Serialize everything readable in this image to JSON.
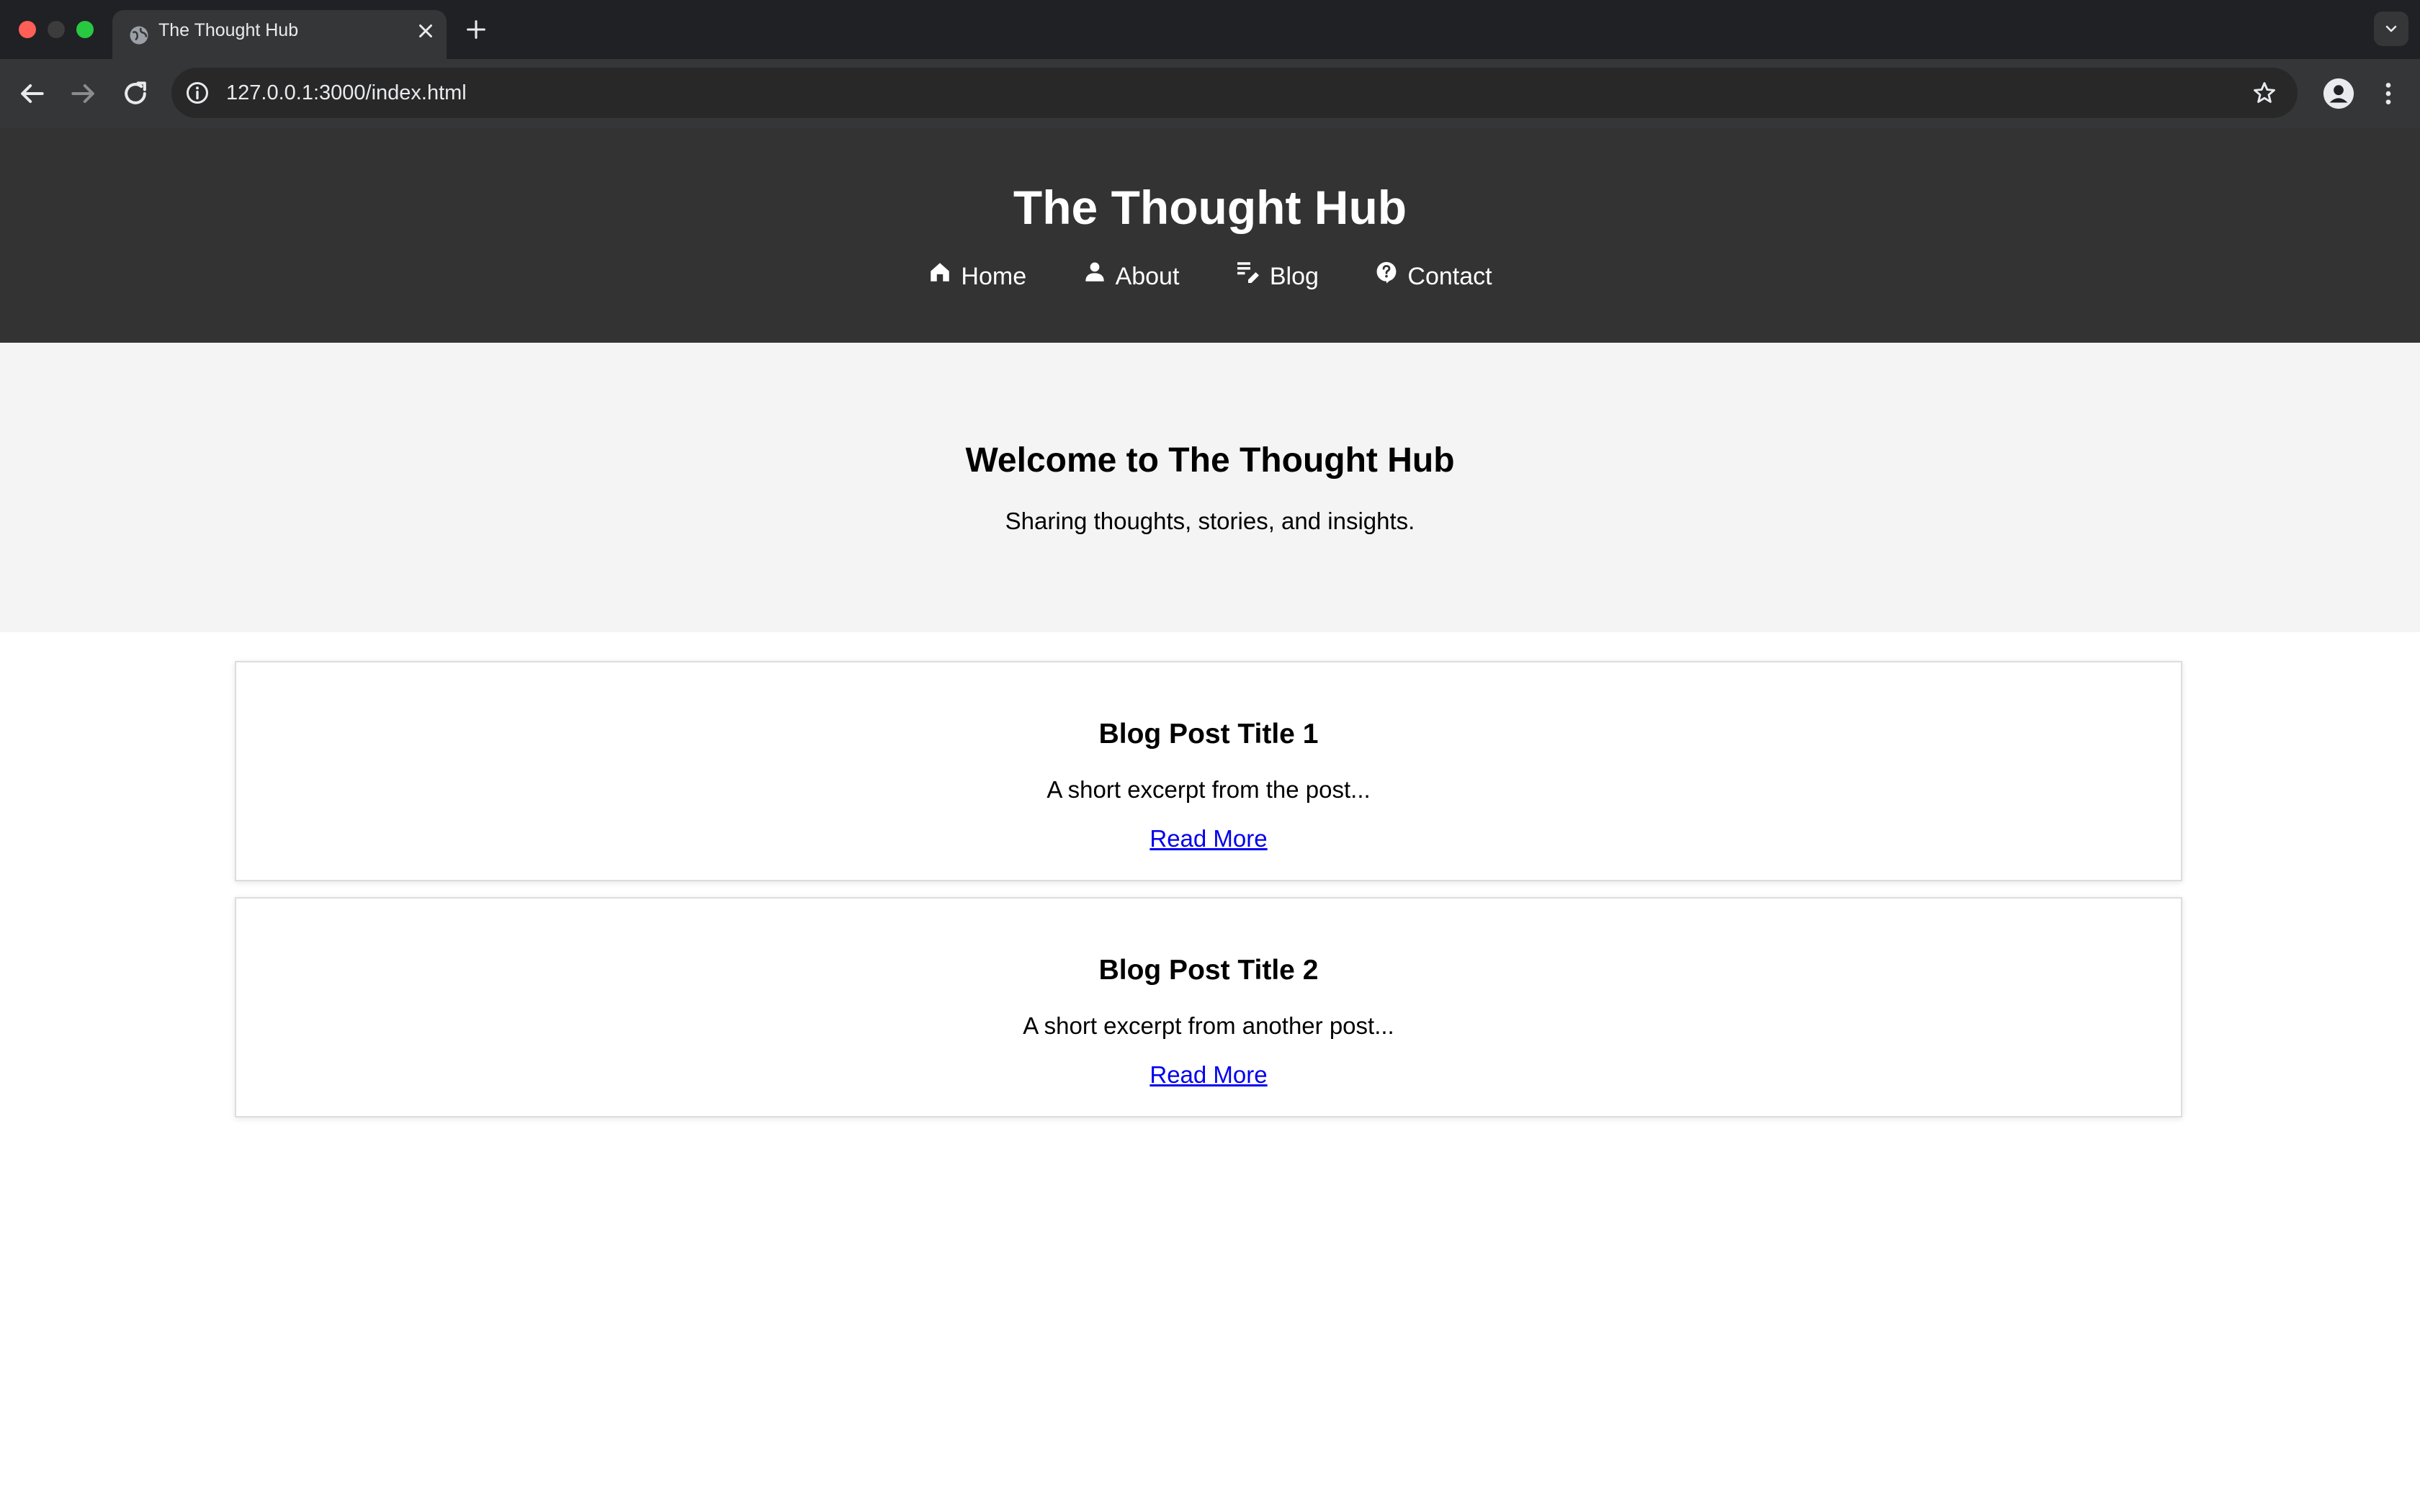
{
  "browser": {
    "tab": {
      "title": "The Thought Hub"
    },
    "address_bar": {
      "url": "127.0.0.1:3000/index.html"
    }
  },
  "header": {
    "title": "The Thought Hub",
    "nav": [
      {
        "label": "Home",
        "icon": "home-icon"
      },
      {
        "label": "About",
        "icon": "person-icon"
      },
      {
        "label": "Blog",
        "icon": "edit-list-icon"
      },
      {
        "label": "Contact",
        "icon": "help-bubble-icon"
      }
    ]
  },
  "hero": {
    "title": "Welcome to The Thought Hub",
    "subtitle": "Sharing thoughts, stories, and insights."
  },
  "posts": [
    {
      "title": "Blog Post Title 1",
      "excerpt": "A short excerpt from the post...",
      "link_label": "Read More"
    },
    {
      "title": "Blog Post Title 2",
      "excerpt": "A short excerpt from another post...",
      "link_label": "Read More"
    }
  ],
  "colors": {
    "header_bg": "#333333",
    "hero_bg": "#f4f4f4",
    "link": "#0000ee"
  }
}
